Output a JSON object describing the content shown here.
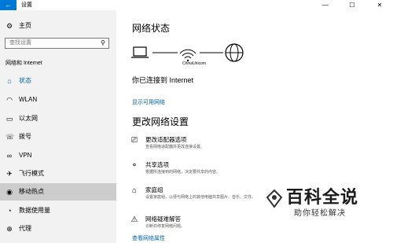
{
  "window": {
    "title": "设置",
    "back_icon": "arrow-left-icon",
    "minimize_glyph": "—",
    "maximize_glyph": "☐",
    "close_glyph": "✕"
  },
  "sidebar": {
    "home_label": "主页",
    "search_placeholder": "查找设置",
    "section_title": "网络和 Internet",
    "items": [
      {
        "label": "状态",
        "icon": "home-status-icon"
      },
      {
        "label": "WLAN",
        "icon": "wifi-icon"
      },
      {
        "label": "以太网",
        "icon": "ethernet-icon"
      },
      {
        "label": "拨号",
        "icon": "phone-icon"
      },
      {
        "label": "VPN",
        "icon": "vpn-icon"
      },
      {
        "label": "飞行模式",
        "icon": "airplane-icon"
      },
      {
        "label": "移动热点",
        "icon": "hotspot-icon"
      },
      {
        "label": "数据使用量",
        "icon": "data-usage-icon"
      },
      {
        "label": "代理",
        "icon": "globe-icon"
      }
    ],
    "selected_item": "状态",
    "active_item": "移动热点"
  },
  "main": {
    "network_status_heading": "网络状态",
    "network_name": "ChinaUnicom",
    "connection_status": "你已连接到 Internet",
    "show_networks_link": "显示可用网络",
    "change_settings_heading": "更改网络设置",
    "options": [
      {
        "title": "更改适配器选项",
        "desc": "查看网络适配器并更改连接设置。",
        "icon": "adapter-icon"
      },
      {
        "title": "共享选项",
        "desc": "根据所连接到的网络，决定要共享的内容。",
        "icon": "share-icon"
      },
      {
        "title": "家庭组",
        "desc": "设置家庭组，以便与网络上的其他电脑共享图片、音乐、文件。",
        "icon": "homegroup-icon"
      },
      {
        "title": "网络疑难解答",
        "desc": "诊断并修复网络问题。",
        "icon": "warning-icon"
      }
    ],
    "properties_link": "查看网络属性"
  },
  "watermark": {
    "brand": "百科全说",
    "slogan": "助你轻松解决"
  },
  "colors": {
    "accent": "#0078d7",
    "link": "#0063b1",
    "sidebar_bg": "#f2f2f2",
    "active_bg": "#cccccc"
  }
}
